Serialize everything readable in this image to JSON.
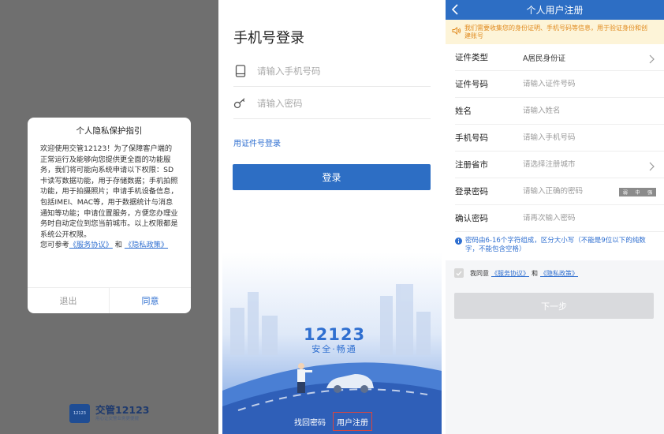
{
  "privacy": {
    "title": "个人隐私保护指引",
    "body": "欢迎使用交管12123！为了保障客户端的正常运行及能够向您提供更全面的功能服务，我们将可能向系统申请以下权限：SD卡读写数据功能，用于存储数据；手机拍照功能，用于拍摄照片；申请手机设备信息，包括IMEI、MAC等，用于数据统计与消息通知等功能；申请位置服务，方便您办理业务时自动定位到您当前城市。以上权限都是系统公开权限。",
    "refer_prefix": "您可参考",
    "service_link": "《服务协议》",
    "and": "和",
    "privacy_link": "《隐私政策》",
    "exit_label": "退出",
    "agree_label": "同意"
  },
  "brand": {
    "name": "交管12123",
    "sub": "用心让交警业务更便捷",
    "logo_text": "12123"
  },
  "login": {
    "title": "手机号登录",
    "phone_placeholder": "请输入手机号码",
    "password_placeholder": "请输入密码",
    "cert_login": "用证件号登录",
    "login_button": "登录",
    "slogan_num": "12123",
    "slogan_sub": "安全·畅通",
    "forgot_password": "找回密码",
    "register": "用户注册"
  },
  "register": {
    "title": "个人用户注册",
    "notice": "我们需要收集您的身份证明、手机号码等信息，用于验证身份和创建账号",
    "rows": [
      {
        "label": "证件类型",
        "value": "A居民身份证"
      },
      {
        "label": "证件号码",
        "placeholder": "请输入证件号码"
      },
      {
        "label": "姓名",
        "placeholder": "请输入姓名"
      },
      {
        "label": "手机号码",
        "placeholder": "请输入手机号码"
      },
      {
        "label": "注册省市",
        "placeholder": "请选择注册城市"
      },
      {
        "label": "登录密码",
        "placeholder": "请输入正确的密码"
      },
      {
        "label": "确认密码",
        "placeholder": "请再次输入密码"
      }
    ],
    "strength": [
      "弱",
      "中",
      "强"
    ],
    "pw_tip": "密码由6-16个字符组成，区分大小写（不能是9位以下的纯数字，不能包含空格）",
    "agree_prefix": "我同意",
    "service_link": "《服务协议》",
    "and": "和",
    "privacy_link": "《隐私政策》",
    "next_button": "下一步"
  },
  "colors": {
    "primary": "#2d6ec4",
    "link": "#2f6fd0",
    "notice_bg": "#fdf4d8",
    "notice_text": "#e08a1e",
    "overlay": "#6f6f6f"
  }
}
